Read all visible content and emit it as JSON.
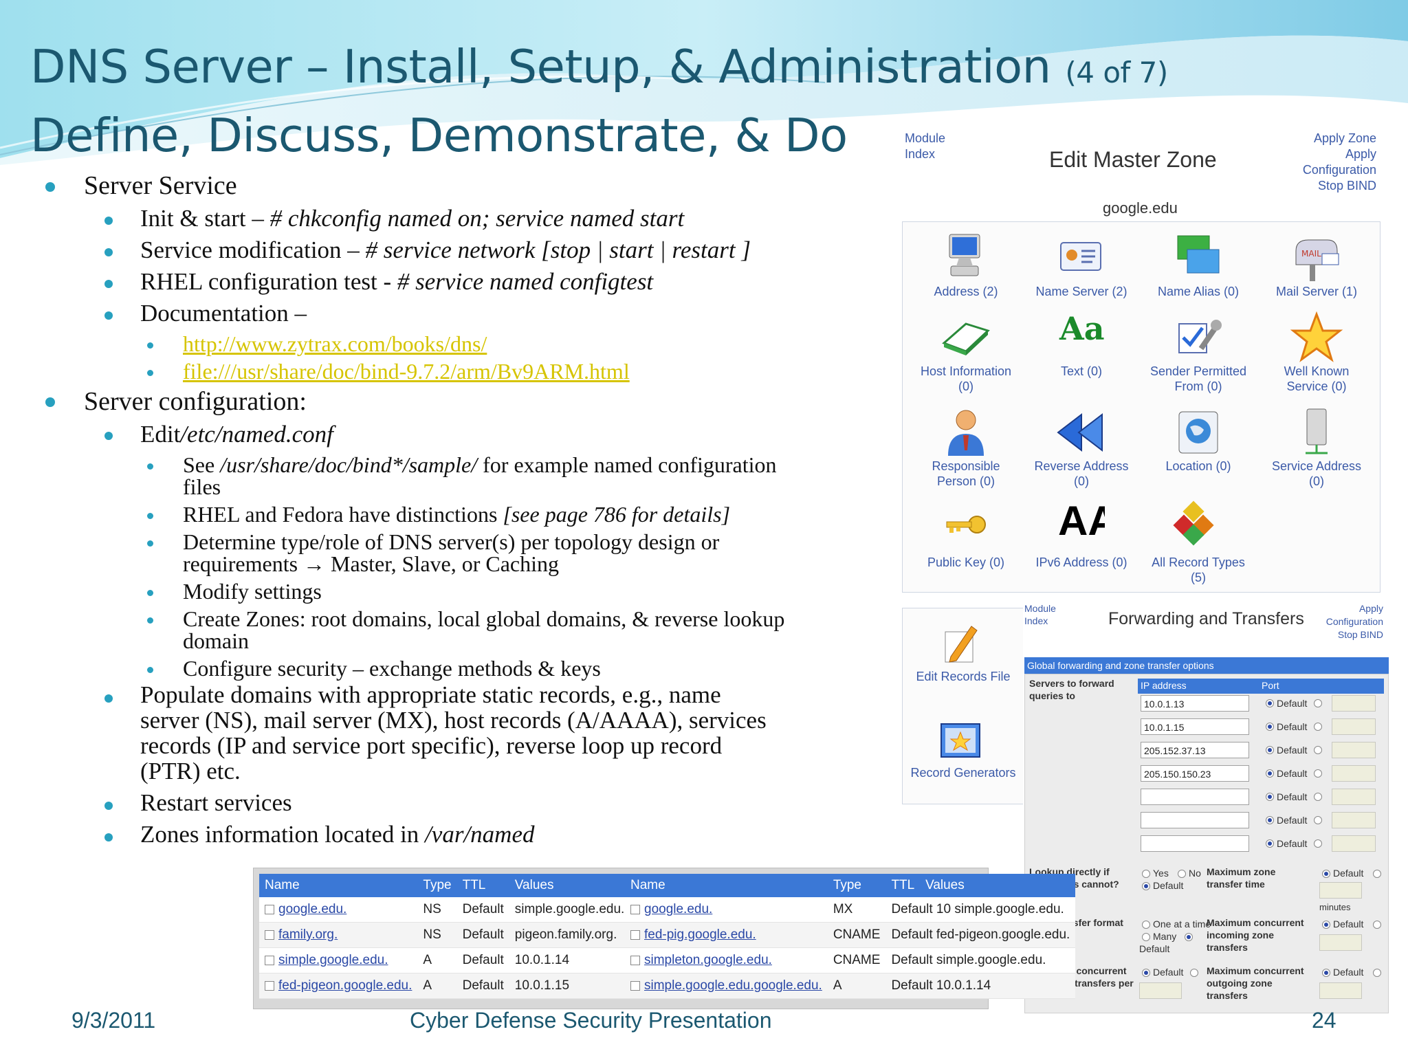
{
  "slide": {
    "title_main": "DNS Server – Install, Setup, & Administration",
    "title_counter": "(4 of 7)",
    "subtitle": "Define, Discuss, Demonstrate, & Do"
  },
  "bullets": {
    "b1": "Server Service",
    "b1_1_pre": "Init & start – ",
    "b1_1_cmd": "# chkconfig named on; service named start",
    "b1_2_pre": "Service modification – ",
    "b1_2_cmd": "# service network [stop | start | restart ]",
    "b1_3_pre": "RHEL configuration test - ",
    "b1_3_cmd": "# service named configtest",
    "b1_4": "Documentation –",
    "link1": "http://www.zytrax.com/books/dns/",
    "link2": "file:///usr/share/doc/bind-9.7.2/arm/Bv9ARM.html",
    "b2": "Server configuration:",
    "b2_1_pre": "Edit",
    "b2_1_path": "/etc/named.conf",
    "b2_1_1_pre": "See ",
    "b2_1_1_path": "/usr/share/doc/bind*/sample/",
    "b2_1_1_post": " for example named configuration",
    "b2_1_1_cont": "files",
    "b2_1_2_pre": "RHEL and Fedora have distinctions ",
    "b2_1_2_ital": "[see page 786 for details]",
    "b2_1_3": "Determine type/role of DNS server(s) per topology design or",
    "b2_1_3_cont": "requirements → Master, Slave, or Caching",
    "b2_1_4": "Modify settings",
    "b2_1_5": "Create Zones: root domains, local global domains, & reverse lookup",
    "b2_1_5_cont": "domain",
    "b2_1_6": "Configure security – exchange methods & keys",
    "b2_2_l1": "Populate domains with appropriate static records, e.g., name",
    "b2_2_l2": "server (NS), mail server  (MX), host records (A/AAAA), services",
    "b2_2_l3": "records (IP and service port specific), reverse loop up record",
    "b2_2_l4": "(PTR) etc.",
    "b2_3": "Restart services",
    "b2_4_pre": "Zones information located in ",
    "b2_4_path": "/var/named"
  },
  "edit_master_zone": {
    "module_index": [
      "Module",
      "Index"
    ],
    "title": "Edit Master Zone",
    "apply_links": [
      "Apply Zone",
      "Apply",
      "Configuration",
      "Stop BIND"
    ],
    "zone_name": "google.edu",
    "icons": [
      {
        "icon": "computer-icon",
        "label1": "Address (2)",
        "label2": ""
      },
      {
        "icon": "name-card-icon",
        "label1": "Name Server (2)",
        "label2": ""
      },
      {
        "icon": "windows-icon",
        "label1": "Name Alias (0)",
        "label2": ""
      },
      {
        "icon": "mailbox-icon",
        "label1": "Mail Server (1)",
        "label2": ""
      },
      {
        "icon": "book-icon",
        "label1": "Host Information",
        "label2": "(0)"
      },
      {
        "icon": "font-icon",
        "label1": "Text (0)",
        "label2": ""
      },
      {
        "icon": "tools-icon",
        "label1": "Sender Permitted",
        "label2": "From (0)"
      },
      {
        "icon": "star-icon",
        "label1": "Well Known",
        "label2": "Service (0)"
      },
      {
        "icon": "person-icon",
        "label1": "Responsible",
        "label2": "Person (0)"
      },
      {
        "icon": "rewind-icon",
        "label1": "Reverse Address",
        "label2": "(0)"
      },
      {
        "icon": "globe-icon",
        "label1": "Location (0)",
        "label2": ""
      },
      {
        "icon": "server-icon",
        "label1": "Service Address",
        "label2": "(0)"
      },
      {
        "icon": "key-icon",
        "label1": "Public Key (0)",
        "label2": ""
      },
      {
        "icon": "aaaa-icon",
        "label1": "IPv6 Address (0)",
        "label2": ""
      },
      {
        "icon": "cubes-icon",
        "label1": "All Record Types",
        "label2": "(5)"
      }
    ],
    "aaaa_glyph": "AA",
    "font_glyph": "Aa",
    "extra_icons": [
      {
        "icon": "pencil-icon",
        "label": "Edit Records File"
      },
      {
        "icon": "wand-icon",
        "label": "Record Generators"
      }
    ]
  },
  "forwarding": {
    "module_index": [
      "Module",
      "Index"
    ],
    "title": "Forwarding and Transfers",
    "apply_links": [
      "Apply",
      "Configuration",
      "Stop BIND"
    ],
    "section_title": "Global forwarding and zone transfer options",
    "servers_label": [
      "Servers to forward",
      "queries to"
    ],
    "col_ip": "IP address",
    "col_port": "Port",
    "ips": [
      "10.0.1.13",
      "10.0.1.15",
      "205.152.37.13",
      "205.150.150.23",
      "",
      "",
      ""
    ],
    "default_label": "Default",
    "lookup_label": [
      "Lookup directly if",
      "forwarders cannot?"
    ],
    "yes": "Yes",
    "no": "No",
    "max_zone_label": [
      "Maximum zone",
      "transfer time"
    ],
    "minutes": "minutes",
    "zt_format_label": "Zone transfer format",
    "one_at_a_time": "One at a time",
    "many": "Many",
    "max_conc_in_label": [
      "Maximum concurrent",
      "incoming zone",
      "transfers"
    ],
    "max_conc_in_server_label": [
      "Maximum concurrent",
      "incoming transfers per",
      "server"
    ],
    "max_conc_out_label": [
      "Maximum concurrent",
      "outgoing zone",
      "transfers"
    ]
  },
  "records_tables": {
    "headers": [
      "Name",
      "Type",
      "TTL",
      "Values"
    ],
    "left": [
      [
        "google.edu.",
        "NS",
        "Default",
        "simple.google.edu."
      ],
      [
        "family.org.",
        "NS",
        "Default",
        "pigeon.family.org."
      ],
      [
        "simple.google.edu.",
        "A",
        "Default",
        "10.0.1.14"
      ],
      [
        "fed-pigeon.google.edu.",
        "A",
        "Default",
        "10.0.1.15"
      ]
    ],
    "right": [
      [
        "google.edu.",
        "MX",
        "Default 10 simple.google.edu.",
        ""
      ],
      [
        "fed-pig.google.edu.",
        "CNAME",
        "Default fed-pigeon.google.edu.",
        ""
      ],
      [
        "simpleton.google.edu.",
        "CNAME",
        "Default simple.google.edu.",
        ""
      ],
      [
        "simple.google.edu.google.edu.",
        "A",
        "Default 10.0.1.14",
        ""
      ]
    ]
  },
  "footer": {
    "date": "9/3/2011",
    "center": "Cyber Defense Security Presentation",
    "page": "24"
  },
  "colors": {
    "title": "#1b5870",
    "bullet": "#27a0bf",
    "link": "#d6c400",
    "webmin_link": "#3b5aa8",
    "table_header": "#3b78d6"
  }
}
